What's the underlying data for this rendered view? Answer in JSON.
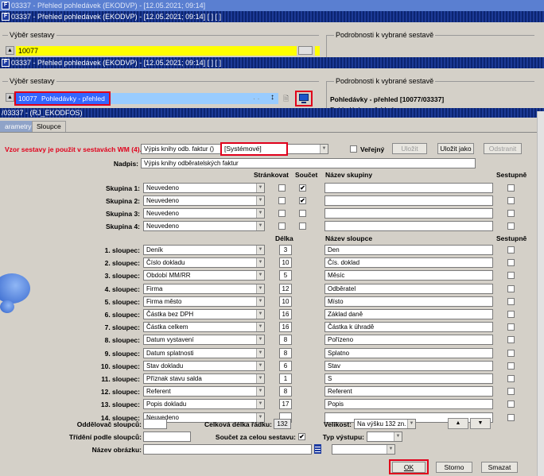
{
  "window1": {
    "title": "03337 - Přehled pohledávek (EKODVP) - [12.05.2021; 09:14]"
  },
  "window2": {
    "title": "03337 - Přehled pohledávek (EKODVP) - [12.05.2021; 09:14]  [ ]  [ ]",
    "group_left": "Výběr sestavy",
    "group_right": "Podrobnosti k vybrané sestavě",
    "value": "10077"
  },
  "window3": {
    "title": "03337 - Přehled pohledávek (EKODVP) - [12.05.2021; 09:14]  [ ]  [ ]",
    "group_left": "Výběr sestavy",
    "group_right": "Podrobnosti k vybrané sestavě",
    "sel_code": "10077",
    "sel_name": "Pohledávky - přehled",
    "detail": "Pohledávky - přehled [10077/03337]",
    "detail2": "Pohledávky - přehled"
  },
  "dialog": {
    "title": "/03337 - (RJ_EKODFOS)",
    "tabs": [
      "arametry",
      "Sloupce"
    ],
    "vzor_label": "Vzor sestavy je použit v sestavách WM (4).",
    "vzor_value": "Výpis knihy odb. faktur  ()",
    "vzor_sys": "[Systémové]",
    "verejny": "Veřejný",
    "btn_ulozit": "Uložit",
    "btn_ulozit_jako": "Uložit jako",
    "btn_odstranit": "Odstranit",
    "nadpis_label": "Nadpis:",
    "nadpis_value": "Výpis knihy odběratelských faktur",
    "hdr_strankovat": "Stránkovat",
    "hdr_soucet": "Součet",
    "hdr_nazev_skupiny": "Název skupiny",
    "hdr_sestupne": "Sestupně",
    "groups": [
      {
        "label": "Skupina 1:",
        "value": "Neuvedeno",
        "soucet": "✔"
      },
      {
        "label": "Skupina 2:",
        "value": "Neuvedeno",
        "soucet": "✔"
      },
      {
        "label": "Skupina 3:",
        "value": "Neuvedeno",
        "soucet": ""
      },
      {
        "label": "Skupina 4:",
        "value": "Neuvedeno",
        "soucet": ""
      }
    ],
    "hdr_delka": "Délka",
    "hdr_nazev_sloupce": "Název sloupce",
    "columns": [
      {
        "label": "1. sloupec:",
        "value": "Deník",
        "len": "3",
        "name": "Den"
      },
      {
        "label": "2. sloupec:",
        "value": "Číslo dokladu",
        "len": "10",
        "name": "Čís. doklad"
      },
      {
        "label": "3. sloupec:",
        "value": "Období MM/RR",
        "len": "5",
        "name": "Měsíc"
      },
      {
        "label": "4. sloupec:",
        "value": "Firma",
        "len": "12",
        "name": "Odběratel"
      },
      {
        "label": "5. sloupec:",
        "value": "Firma město",
        "len": "10",
        "name": "Místo"
      },
      {
        "label": "6. sloupec:",
        "value": "Částka bez DPH",
        "len": "16",
        "name": "Základ daně"
      },
      {
        "label": "7. sloupec:",
        "value": "Částka celkem",
        "len": "16",
        "name": "Částka k úhradě"
      },
      {
        "label": "8. sloupec:",
        "value": "Datum vystavení",
        "len": "8",
        "name": "Pořízeno"
      },
      {
        "label": "9. sloupec:",
        "value": "Datum splatnosti",
        "len": "8",
        "name": "Splatno"
      },
      {
        "label": "10. sloupec:",
        "value": "Stav dokladu",
        "len": "6",
        "name": "Stav"
      },
      {
        "label": "11. sloupec:",
        "value": "Příznak stavu salda",
        "len": "1",
        "name": "S"
      },
      {
        "label": "12. sloupec:",
        "value": "Referent",
        "len": "8",
        "name": "Referent"
      },
      {
        "label": "13. sloupec:",
        "value": "Popis dokladu",
        "len": "17",
        "name": "Popis"
      },
      {
        "label": "14. sloupec:",
        "value": "Neuvedeno",
        "len": "",
        "name": ""
      }
    ],
    "oddelovac": "Oddělovač sloupců:",
    "celkova": "Celková délka řádku:",
    "celkova_val": "132",
    "velikost": "Velikost:",
    "velikost_val": "Na výšku 132 zn.",
    "trideni": "Třídění podle sloupců:",
    "soucet_cela": "Součet za celou sestavu:",
    "typ_vystupu": "Typ výstupu:",
    "nazev_obrazku": "Název obrázku:",
    "btn_ok": "OK",
    "btn_storno": "Storno",
    "btn_smazat": "Smazat"
  }
}
